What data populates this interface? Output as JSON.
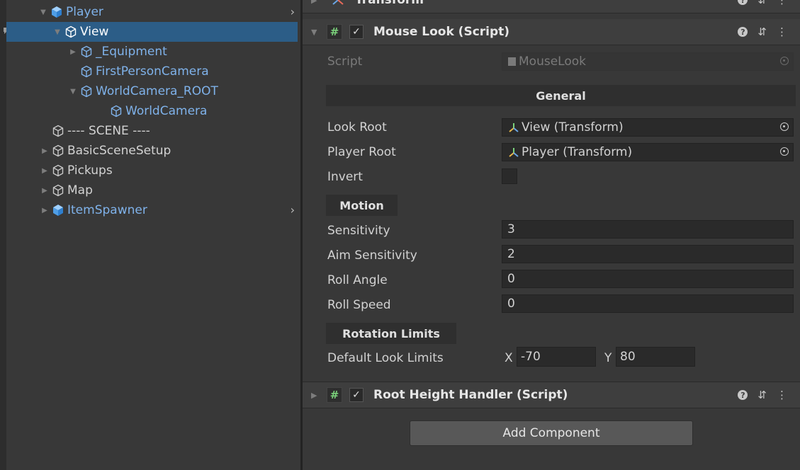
{
  "hierarchy": {
    "items": [
      {
        "label": "Player",
        "style": "blue",
        "prefab": true,
        "fold": "open",
        "indent": 1,
        "chevron": true
      },
      {
        "label": "View",
        "style": "white",
        "prefab": false,
        "fold": "open",
        "indent": 2,
        "selected": true
      },
      {
        "label": "_Equipment",
        "style": "blue",
        "prefab": false,
        "fold": "closed",
        "indent": 3
      },
      {
        "label": "FirstPersonCamera",
        "style": "blue",
        "prefab": false,
        "fold": "none",
        "indent": 3
      },
      {
        "label": "WorldCamera_ROOT",
        "style": "blue",
        "prefab": false,
        "fold": "open",
        "indent": 3
      },
      {
        "label": "WorldCamera",
        "style": "blue",
        "prefab": false,
        "fold": "none",
        "indent": 4
      },
      {
        "label": "---- SCENE ----",
        "style": "grey",
        "prefab": false,
        "fold": "none",
        "indent": 0
      },
      {
        "label": "BasicSceneSetup",
        "style": "grey",
        "prefab": false,
        "fold": "closed",
        "indent": 0
      },
      {
        "label": "Pickups",
        "style": "grey",
        "prefab": false,
        "fold": "closed",
        "indent": 0
      },
      {
        "label": "Map",
        "style": "grey",
        "prefab": false,
        "fold": "closed",
        "indent": 0
      },
      {
        "label": "ItemSpawner",
        "style": "blue",
        "prefab": true,
        "fold": "closed",
        "indent": 0,
        "chevron": true
      }
    ]
  },
  "inspector": {
    "transform_header": {
      "title": "Transform"
    },
    "mouse_look": {
      "title": "Mouse Look (Script)",
      "script_label": "Script",
      "script_value": "MouseLook",
      "general_header": "General",
      "look_root_label": "Look Root",
      "look_root_value": "View (Transform)",
      "player_root_label": "Player Root",
      "player_root_value": "Player (Transform)",
      "invert_label": "Invert",
      "motion_header": "Motion",
      "sensitivity_label": "Sensitivity",
      "sensitivity_value": "3",
      "aim_sensitivity_label": "Aim Sensitivity",
      "aim_sensitivity_value": "2",
      "roll_angle_label": "Roll Angle",
      "roll_angle_value": "0",
      "roll_speed_label": "Roll Speed",
      "roll_speed_value": "0",
      "rotation_limits_header": "Rotation Limits",
      "default_look_limits_label": "Default Look Limits",
      "x_label": "X",
      "x_value": "-70",
      "y_label": "Y",
      "y_value": "80"
    },
    "root_height": {
      "title": "Root Height Handler (Script)"
    },
    "add_component_label": "Add Component"
  },
  "colors": {
    "selection": "#2c5d87",
    "prefab_blue": "#7fb2ea",
    "hash_green": "#7bd17b",
    "transform_axis": "#e8b84a"
  }
}
